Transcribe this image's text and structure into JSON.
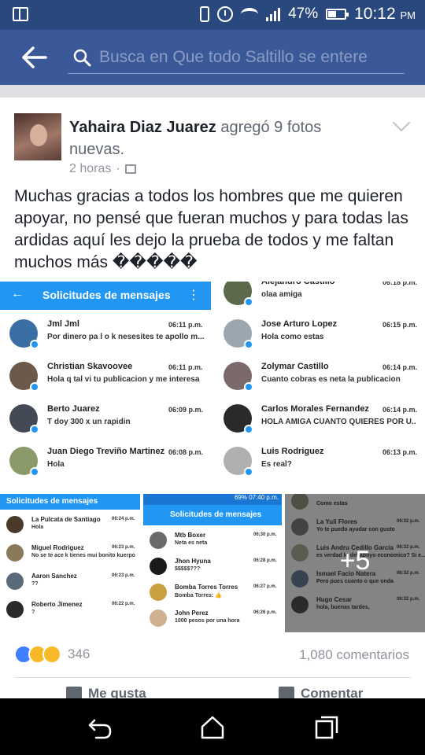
{
  "status_bar": {
    "battery": "47%",
    "time": "10:12",
    "ampm": "PM"
  },
  "search": {
    "placeholder": "Busca en Que todo Saltillo se entere"
  },
  "post": {
    "author": "Yahaira Diaz Juarez",
    "action": "agregó 9 fotos nuevas.",
    "time": "2 horas",
    "text": "Muchas gracias a todos los hombres que me quieren apoyar, no pensé que fueran muchos y para todas las ardidas aquí les dejo la prueba de todos y me faltan muchos más �����"
  },
  "photo_main": {
    "header": {
      "back": "←",
      "title": "Solicitudes de mensajes",
      "menu": "⋮"
    },
    "left_chats": [
      {
        "name": "Jml Jml",
        "time": "06:11 p.m.",
        "message": "Por dinero pa l o k nesesites te apollo m...",
        "avatar_color": "#3b6ea5"
      },
      {
        "name": "Christian Skavoovee",
        "time": "06:11 p.m.",
        "message": "Hola q tal vi tu publicacion y me interesa",
        "avatar_color": "#6b5a4a"
      },
      {
        "name": "Berto Juarez",
        "time": "06:09 p.m.",
        "message": "T doy 300 x un rapidin",
        "avatar_color": "#444a55"
      },
      {
        "name": "Juan Diego Treviño Martinez",
        "time": "06:08 p.m.",
        "message": "Hola",
        "avatar_color": "#8a9a6a"
      }
    ],
    "right_chats": [
      {
        "name": "Alejandro Castillo",
        "time": "06:18 p.m.",
        "message": "olaa amiga",
        "avatar_color": "#5a6a4a"
      },
      {
        "name": "Jose Arturo Lopez",
        "time": "06:15 p.m.",
        "message": "Hola como estas",
        "avatar_color": "#9aa6b0"
      },
      {
        "name": "Zolymar Castillo",
        "time": "06:14 p.m.",
        "message": "Cuanto cobras es neta la publicacion",
        "avatar_color": "#7a6a6a"
      },
      {
        "name": "Carlos Morales Fernandez",
        "time": "06:14 p.m.",
        "message": "HOLA AMIGA CUANTO QUIERES POR U...",
        "avatar_color": "#2a2a2a"
      },
      {
        "name": "Luis Rodriguez",
        "time": "06:13 p.m.",
        "message": "Es real?",
        "avatar_color": "#b0b0b0"
      }
    ]
  },
  "thumb1": {
    "title": "Solicitudes de mensajes",
    "chats": [
      {
        "name": "La Pulcata de Santiago",
        "time": "06:24 p.m.",
        "message": "Hola",
        "avatar_color": "#4a3a2a"
      },
      {
        "name": "Miguel Rodriguez",
        "time": "06:23 p.m.",
        "message": "No se te ace k tienes mui bonito kuerpo",
        "avatar_color": "#8a7a5a"
      },
      {
        "name": "Aaron Sanchez",
        "time": "06:23 p.m.",
        "message": "??",
        "avatar_color": "#5a6a7a"
      },
      {
        "name": "Roberto Jimenez",
        "time": "06:22 p.m.",
        "message": "?",
        "avatar_color": "#2a2a2a"
      }
    ]
  },
  "thumb2": {
    "status": "69% 07:40 p.m.",
    "title": "Solicitudes de mensajes",
    "chats": [
      {
        "name": "Mtb Boxer",
        "time": "06:30 p.m.",
        "message": "Neta es neta",
        "avatar_color": "#6a6a6a"
      },
      {
        "name": "Jhon Hyuna",
        "time": "06:28 p.m.",
        "message": "$$$$$???",
        "avatar_color": "#1a1a1a"
      },
      {
        "name": "Bomba Torres Torres",
        "time": "06:27 p.m.",
        "message": "Bomba Torres: 👍",
        "avatar_color": "#c8a040"
      },
      {
        "name": "John Perez",
        "time": "06:26 p.m.",
        "message": "1000 pesos por una hora",
        "avatar_color": "#d0b090"
      }
    ]
  },
  "thumb3": {
    "more": "+5",
    "chats": [
      {
        "name": "",
        "time": "",
        "message": "Como estas",
        "avatar_color": "#6a6a5a"
      },
      {
        "name": "La Yuli Flores",
        "time": "06:32 p.m.",
        "message": "Yo te puedo ayudar con gusto",
        "avatar_color": "#5a5a5a"
      },
      {
        "name": "Luis Andru Cedillo Garcia",
        "time": "06:32 p.m.",
        "message": "es verdad lo del apoyo economico? Si e...",
        "avatar_color": "#7a7a6a"
      },
      {
        "name": "Ismael Facio Natera",
        "time": "06:32 p.m.",
        "message": "Pero pues cuanto o que onda",
        "avatar_color": "#4a5a6a"
      },
      {
        "name": "Hugo Cesar",
        "time": "06:32 p.m.",
        "message": "hola, buenas tardes,",
        "avatar_color": "#3a3a3a"
      }
    ]
  },
  "reactions": {
    "count": "346",
    "comments": "1,080 comentarios"
  },
  "actions": {
    "like": "Me gusta",
    "comment": "Comentar"
  },
  "colors": {
    "brand": "#3b5998",
    "status_bar": "#29487d",
    "messenger_blue": "#2196f3"
  }
}
